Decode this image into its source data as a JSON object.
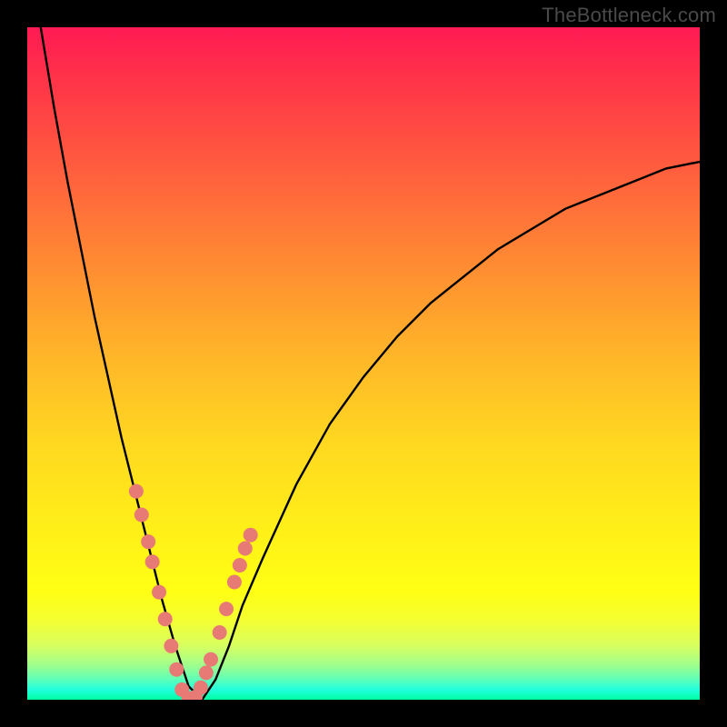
{
  "watermark": "TheBottleneck.com",
  "colors": {
    "background": "#000000",
    "curve": "#000000",
    "marker_fill": "#e77a74",
    "marker_stroke": "#c95c56"
  },
  "chart_data": {
    "type": "line",
    "title": "",
    "xlabel": "",
    "ylabel": "",
    "xlim": [
      0,
      100
    ],
    "ylim": [
      0,
      100
    ],
    "description": "Bottleneck curve: V-shaped distance-from-optimal metric. Minimum (0%) at x≈24 on a green band; rises steeply toward 100% on the left edge and asymptotically toward ~80% on the right.",
    "series": [
      {
        "name": "bottleneck-curve",
        "x": [
          2,
          4,
          6,
          8,
          10,
          12,
          14,
          16,
          18,
          20,
          22,
          24,
          26,
          28,
          30,
          32,
          35,
          40,
          45,
          50,
          55,
          60,
          65,
          70,
          75,
          80,
          85,
          90,
          95,
          100
        ],
        "values": [
          100,
          88,
          77,
          67,
          57,
          48,
          39,
          31,
          23,
          15,
          8,
          2,
          0,
          3,
          8,
          14,
          21,
          32,
          41,
          48,
          54,
          59,
          63,
          67,
          70,
          73,
          75,
          77,
          79,
          80
        ]
      }
    ],
    "markers": {
      "name": "highlighted-points",
      "x": [
        16.2,
        17.0,
        18.0,
        18.6,
        19.6,
        20.5,
        21.4,
        22.2,
        23.0,
        24.0,
        25.0,
        25.8,
        26.6,
        27.3,
        28.6,
        29.6,
        30.8,
        31.6,
        32.4,
        33.2
      ],
      "values": [
        31.0,
        27.5,
        23.5,
        20.5,
        16.0,
        12.0,
        8.0,
        4.5,
        1.5,
        0.2,
        0.4,
        1.8,
        4.0,
        6.0,
        10.0,
        13.5,
        17.5,
        20.0,
        22.5,
        24.5
      ]
    }
  }
}
